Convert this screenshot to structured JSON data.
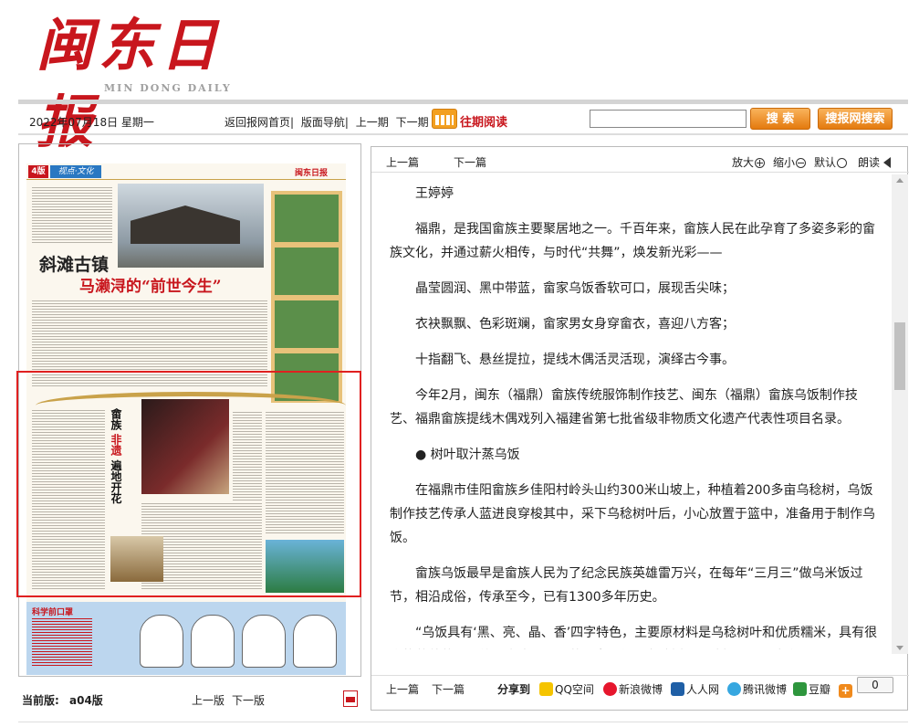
{
  "header": {
    "logo_cn": "闽东日报",
    "logo_en": "MIN DONG DAILY"
  },
  "nav": {
    "date": "2022年07月18日 星期一",
    "links": [
      "返回报网首页|",
      "版面导航|",
      "上一期",
      "下一期"
    ],
    "past_reading": "往期阅读",
    "search_value": "",
    "search_button": "搜 索",
    "web_search_button": "搜报网搜索"
  },
  "left": {
    "page_tag": "4版",
    "section_tag": "视点·文化",
    "paper_brand": "闽东日报",
    "headline_1": "斜滩古镇",
    "headline_2": "马濑浔的“前世今生”",
    "feature_title_1": "畲族",
    "feature_title_2": "非遗",
    "feature_title_3": "遍地开花",
    "science_title": "科学前口罩",
    "current_label": "当前版:",
    "current_value": "a04版",
    "prev": "上一版",
    "next": "下一版"
  },
  "toolbar": {
    "prev_article": "上一篇",
    "next_article": "下一篇",
    "zoom_in": "放大",
    "zoom_out": "缩小",
    "default": "默认",
    "read_aloud": "朗读"
  },
  "article": {
    "author": "王婷婷",
    "paragraphs": [
      "福鼎，是我国畲族主要聚居地之一。千百年来，畲族人民在此孕育了多姿多彩的畲族文化，并通过薪火相传，与时代“共舞”，焕发新光彩——",
      "晶莹圆润、黑中带蓝，畲家乌饭香软可口，展现舌尖味；",
      "衣袂飘飘、色彩斑斓，畲家男女身穿畲衣，喜迎八方客；",
      "十指翻飞、悬丝提拉，提线木偶活灵活现，演绎古今事。",
      "今年2月，闽东（福鼎）畲族传统服饰制作技艺、闽东（福鼎）畲族乌饭制作技艺、福鼎畲族提线木偶戏列入福建省第七批省级非物质文化遗产代表性项目名录。",
      "● 树叶取汁蒸乌饭",
      "在福鼎市佳阳畲族乡佳阳村岭头山约300米山坡上，种植着200多亩乌稔树，乌饭制作技艺传承人蓝进良穿梭其中，采下乌稔树叶后，小心放置于篮中，准备用于制作乌饭。",
      "畲族乌饭最早是畲族人民为了纪念民族英雄雷万兴，在每年“三月三”做乌米饭过节，相沿成俗，传承至今，已有1300多年历史。",
      "“乌饭具有‘黑、亮、晶、香’四字特色，主要原材料是乌稔树叶和优质糯米，具有很高的营养药用价值，食疗同源。”蓝进良介绍，乌稔树叶要选择不带雨水和露"
    ]
  },
  "share": {
    "prev_article": "上一篇",
    "next_article": "下一篇",
    "label": "分享到",
    "targets": [
      "QQ空间",
      "新浪微博",
      "人人网",
      "腾讯微博",
      "豆瓣"
    ],
    "count": "0"
  },
  "colors": {
    "brand_red": "#c8161d",
    "button_orange": "#e47a0e",
    "highlight_box": "#e02020"
  }
}
